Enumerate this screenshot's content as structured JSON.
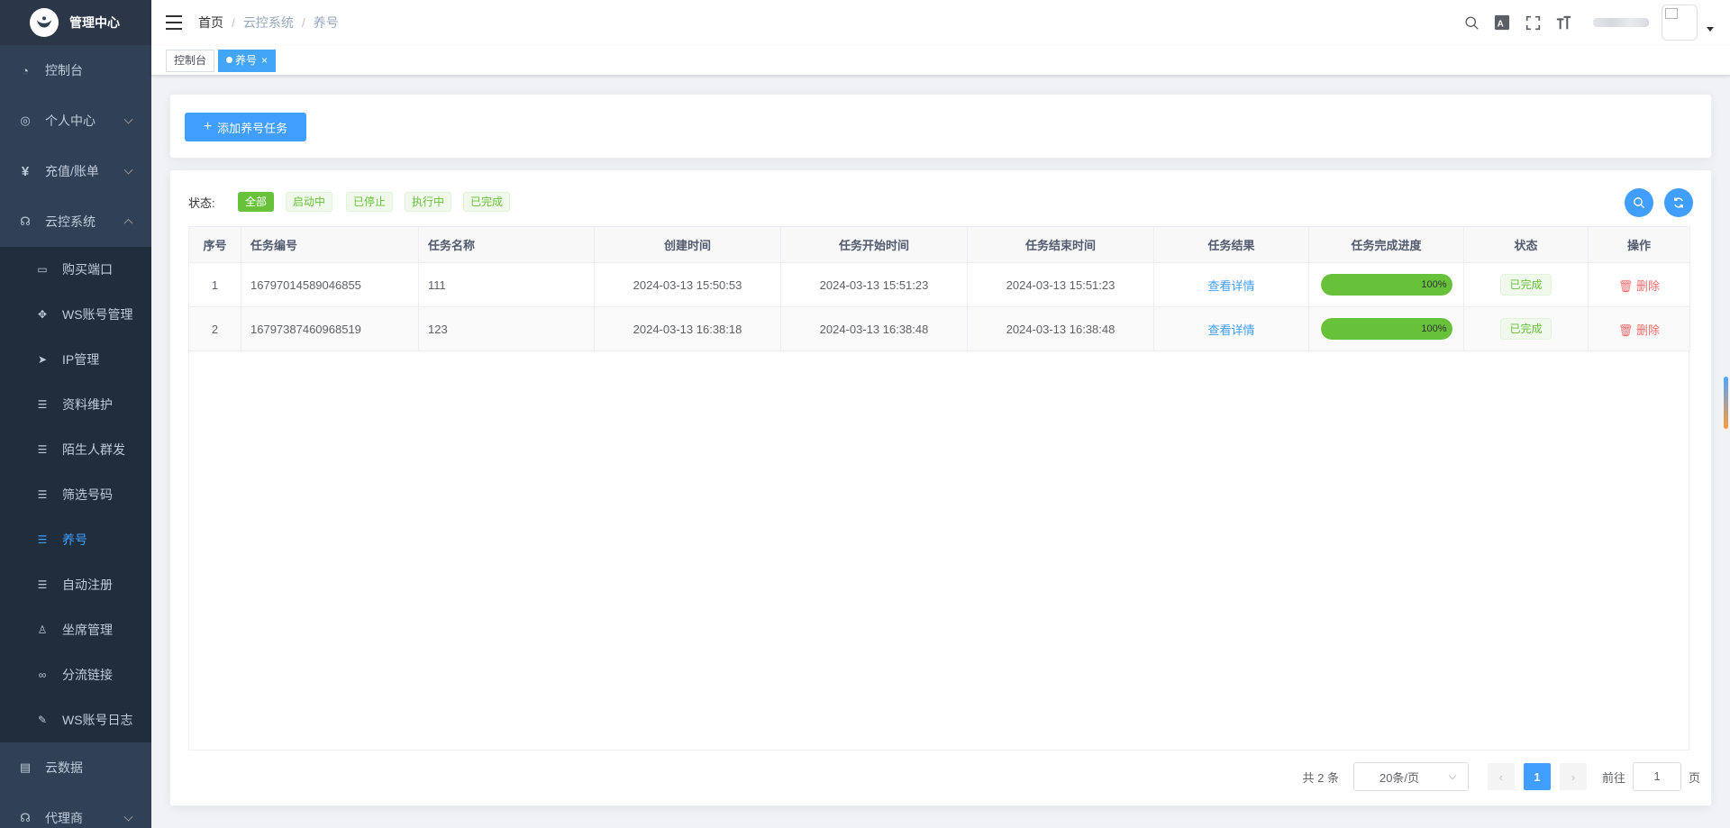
{
  "sidebar": {
    "logo_title": "管理中心",
    "items": [
      {
        "label": "控制台",
        "icon": "dashboard-icon"
      },
      {
        "label": "个人中心",
        "icon": "user-circle-icon"
      },
      {
        "label": "充值/账单",
        "icon": "yen-icon"
      },
      {
        "label": "云控系统",
        "icon": "cloud-control-icon"
      }
    ],
    "sub_items": [
      {
        "label": "购买端口",
        "icon": "wallet-icon"
      },
      {
        "label": "WS账号管理",
        "icon": "move-icon"
      },
      {
        "label": "IP管理",
        "icon": "send-icon"
      },
      {
        "label": "资料维护",
        "icon": "list-icon"
      },
      {
        "label": "陌生人群发",
        "icon": "list-icon"
      },
      {
        "label": "筛选号码",
        "icon": "list-icon"
      },
      {
        "label": "养号",
        "icon": "list-icon"
      },
      {
        "label": "自动注册",
        "icon": "list-icon"
      },
      {
        "label": "坐席管理",
        "icon": "person-icon"
      },
      {
        "label": "分流链接",
        "icon": "link-icon"
      },
      {
        "label": "WS账号日志",
        "icon": "edit-icon"
      }
    ],
    "bottom_items": [
      {
        "label": "云数据",
        "icon": "document-icon"
      },
      {
        "label": "代理商",
        "icon": "headset-icon"
      }
    ]
  },
  "header": {
    "breadcrumb": [
      "首页",
      "云控系统",
      "养号"
    ],
    "breadcrumb_separator": "/"
  },
  "tags": [
    {
      "label": "控制台"
    },
    {
      "label": "养号",
      "close": "×"
    }
  ],
  "toolbar": {
    "add_task_label": "添加养号任务"
  },
  "filter": {
    "label": "状态:",
    "options": [
      "全部",
      "启动中",
      "已停止",
      "执行中",
      "已完成"
    ],
    "selected": "全部"
  },
  "table": {
    "columns": [
      "序号",
      "任务编号",
      "任务名称",
      "创建时间",
      "任务开始时间",
      "任务结束时间",
      "任务结果",
      "任务完成进度",
      "状态",
      "操作"
    ],
    "rows": [
      {
        "index": "1",
        "task_no": "16797014589046855",
        "name": "111",
        "created": "2024-03-13 15:50:53",
        "start": "2024-03-13 15:51:23",
        "end": "2024-03-13 15:51:23",
        "result": "查看详情",
        "progress": "100%",
        "status": "已完成",
        "action": "删除"
      },
      {
        "index": "2",
        "task_no": "16797387460968519",
        "name": "123",
        "created": "2024-03-13 16:38:18",
        "start": "2024-03-13 16:38:48",
        "end": "2024-03-13 16:38:48",
        "result": "查看详情",
        "progress": "100%",
        "status": "已完成",
        "action": "删除"
      }
    ]
  },
  "pagination": {
    "total": "共 2 条",
    "page_size": "20条/页",
    "current": "1",
    "goto_label": "前往",
    "goto_value": "1",
    "page_unit": "页"
  },
  "colors": {
    "primary": "#409eff",
    "success": "#67c23a",
    "danger": "#f56c6c",
    "sidebar_bg": "#304156"
  }
}
